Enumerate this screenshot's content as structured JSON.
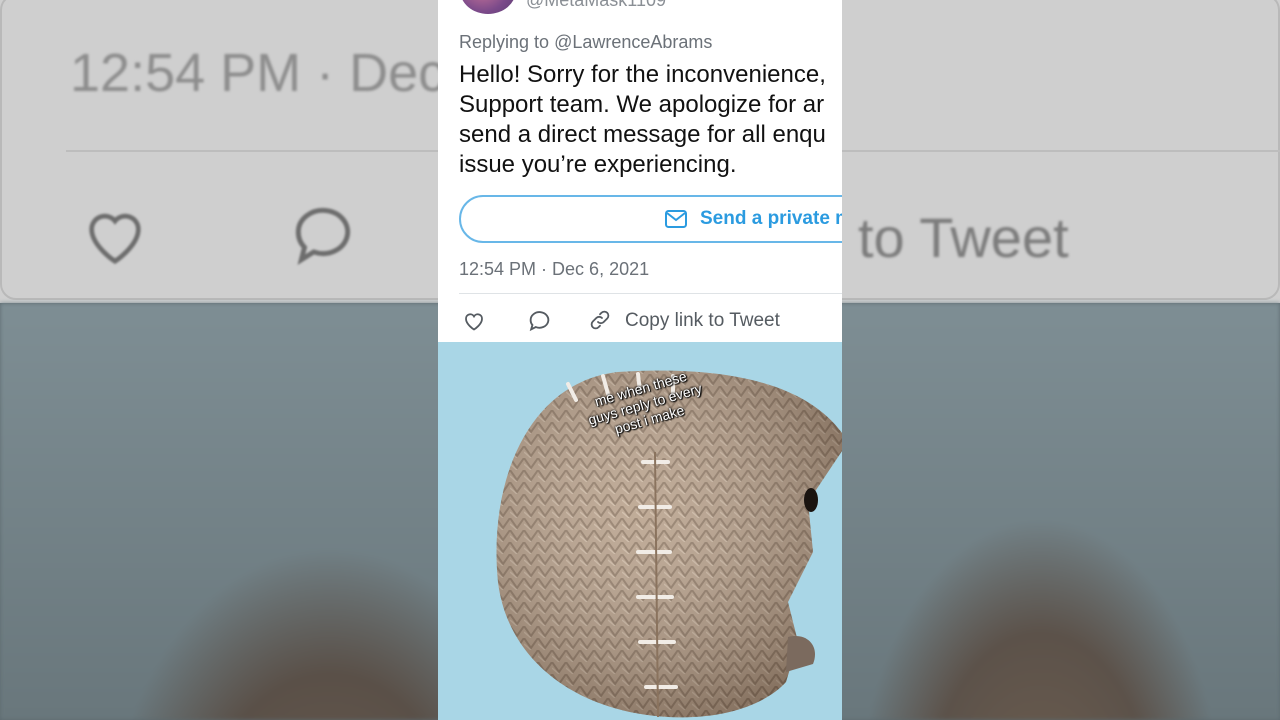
{
  "background": {
    "timestamp_fragment": "12:54 PM · Dec",
    "copy_fragment": "to Tweet"
  },
  "tweet": {
    "handle": "@MetaMask1109",
    "replying_prefix": "Replying to ",
    "replying_mention": "@LawrenceAbrams",
    "text_lines": [
      "Hello! Sorry for the inconvenience,",
      "Support team. We apologize for ar",
      "send a direct message for all enqu",
      "issue you’re experiencing."
    ],
    "dm_button_label": "Send a private m",
    "timestamp": "12:54 PM · Dec 6, 2021",
    "actions": {
      "like_icon": "heart-icon",
      "reply_icon": "comment-icon",
      "link_icon": "link-icon",
      "copy_label": "Copy link to Tweet"
    }
  },
  "meme": {
    "caption_lines": [
      "me when these",
      "guys reply to every",
      "post i make"
    ],
    "background_color": "#a9d6e6"
  },
  "colors": {
    "accent": "#2b9be0",
    "button_border": "#68b7e8",
    "muted_text": "#6b7178"
  }
}
